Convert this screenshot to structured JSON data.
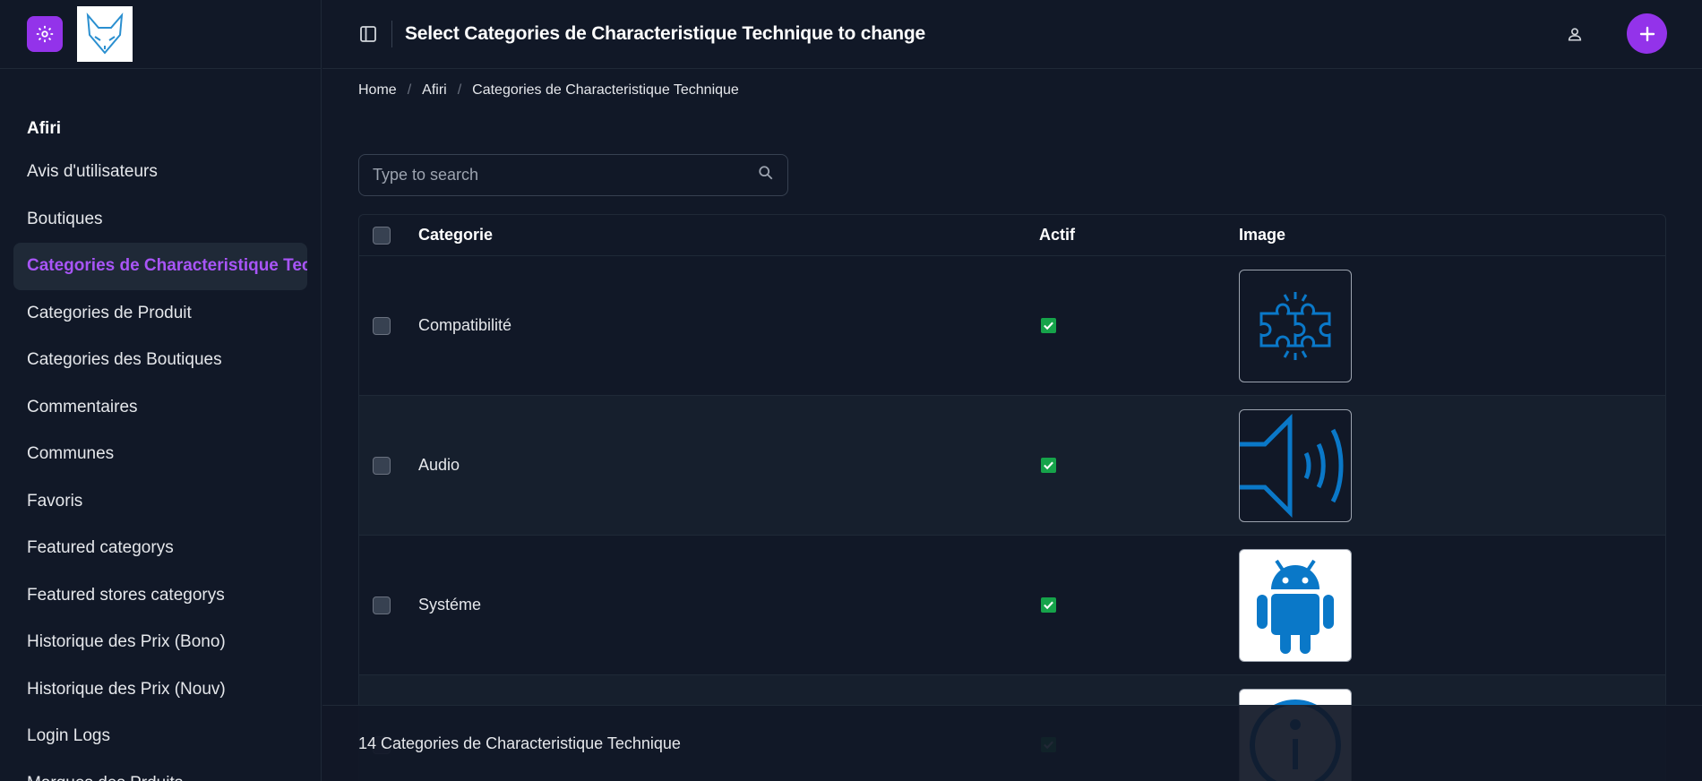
{
  "app": {
    "brand_icon": "gear-icon",
    "logo": "fox-logo"
  },
  "header": {
    "title": "Select Categories de Characteristique Technique to change",
    "toggle_icon": "sidebar-toggle-icon",
    "user_icon": "user-icon",
    "add_icon": "plus-icon"
  },
  "sidebar": {
    "group": "Afiri",
    "items": [
      {
        "label": "Avis d'utilisateurs",
        "active": false
      },
      {
        "label": "Boutiques",
        "active": false
      },
      {
        "label": "Categories de Characteristique Technique",
        "active": true
      },
      {
        "label": "Categories de Produit",
        "active": false
      },
      {
        "label": "Categories des Boutiques",
        "active": false
      },
      {
        "label": "Commentaires",
        "active": false
      },
      {
        "label": "Communes",
        "active": false
      },
      {
        "label": "Favoris",
        "active": false
      },
      {
        "label": "Featured categorys",
        "active": false
      },
      {
        "label": "Featured stores categorys",
        "active": false
      },
      {
        "label": "Historique des Prix (Bono)",
        "active": false
      },
      {
        "label": "Historique des Prix (Nouv)",
        "active": false
      },
      {
        "label": "Login Logs",
        "active": false
      },
      {
        "label": "Marques des Prduits",
        "active": false
      }
    ]
  },
  "breadcrumb": [
    "Home",
    "Afiri",
    "Categories de Characteristique Technique"
  ],
  "search": {
    "placeholder": "Type to search",
    "value": ""
  },
  "table": {
    "columns": [
      "Categorie",
      "Actif",
      "Image"
    ],
    "rows": [
      {
        "categorie": "Compatibilité",
        "actif": true,
        "image": "puzzle-icon"
      },
      {
        "categorie": "Audio",
        "actif": true,
        "image": "speaker-icon"
      },
      {
        "categorie": "Systéme",
        "actif": true,
        "image": "android-icon"
      },
      {
        "categorie": "",
        "actif": true,
        "image": "info-icon"
      }
    ]
  },
  "footer": {
    "count_text": "14 Categories de Characteristique Technique"
  },
  "colors": {
    "accent": "#9333ea",
    "active_text": "#a855f7",
    "icon_blue": "#0a78c8",
    "actif_green": "#16a34a"
  }
}
